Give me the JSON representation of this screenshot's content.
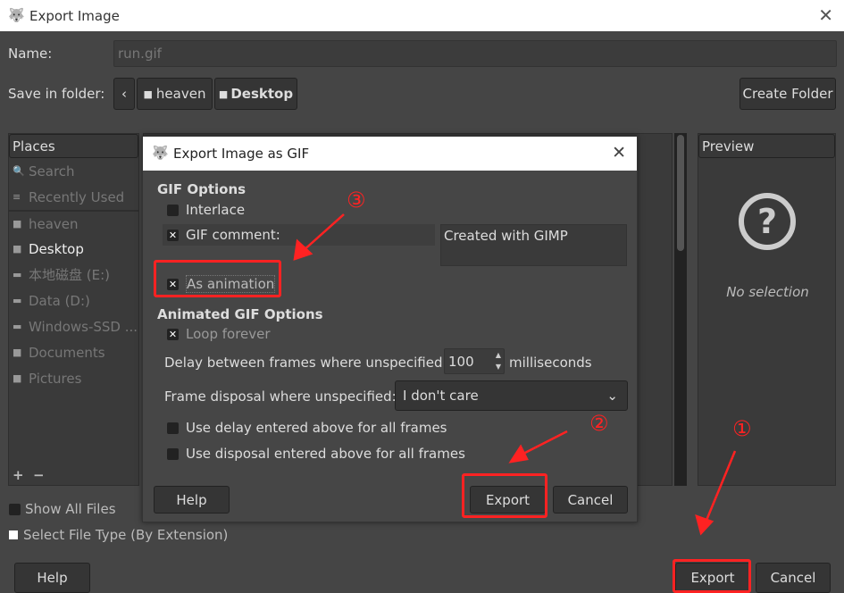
{
  "window": {
    "title": "Export Image",
    "close_icon": "close-icon"
  },
  "name_label": "Name:",
  "name_value": "run.gif",
  "save_in_label": "Save in folder:",
  "breadcrumb": [
    "heaven",
    "Desktop"
  ],
  "create_folder": "Create Folder",
  "places": {
    "header": "Places",
    "items": [
      {
        "label": "Search",
        "icon": "search-icon"
      },
      {
        "label": "Recently Used",
        "icon": "recent-icon"
      },
      {
        "label": "heaven",
        "icon": "folder-icon"
      },
      {
        "label": "Desktop",
        "icon": "folder-icon"
      },
      {
        "label": "本地磁盘 (E:)",
        "icon": "drive-icon"
      },
      {
        "label": "Data (D:)",
        "icon": "drive-icon"
      },
      {
        "label": "Windows-SSD ...",
        "icon": "drive-icon"
      },
      {
        "label": "Documents",
        "icon": "folder-icon"
      },
      {
        "label": "Pictures",
        "icon": "folder-icon"
      }
    ],
    "add": "+",
    "remove": "−"
  },
  "preview": {
    "header": "Preview",
    "no_selection": "No selection",
    "icon": "?"
  },
  "show_all_files": "Show All Files",
  "select_file_type": "Select File Type (By Extension)",
  "buttons": {
    "help": "Help",
    "export": "Export",
    "cancel": "Cancel"
  },
  "dialog": {
    "title": "Export Image as GIF",
    "gif_options": "GIF Options",
    "interlace": "Interlace",
    "gif_comment": "GIF comment:",
    "comment_value": "Created with GIMP",
    "as_animation": "As animation",
    "animated_options": "Animated GIF Options",
    "loop_forever": "Loop forever",
    "delay_label": "Delay between frames where unspecified:",
    "delay_value": "100",
    "delay_unit": "milliseconds",
    "disposal_label": "Frame disposal where unspecified:",
    "disposal_value": "I don't care",
    "use_delay": "Use delay entered above for all frames",
    "use_disposal": "Use disposal entered above for all frames",
    "help": "Help",
    "export": "Export",
    "cancel": "Cancel"
  },
  "annotations": [
    "①",
    "②",
    "③"
  ],
  "colors": {
    "annotation": "#ff2222"
  }
}
